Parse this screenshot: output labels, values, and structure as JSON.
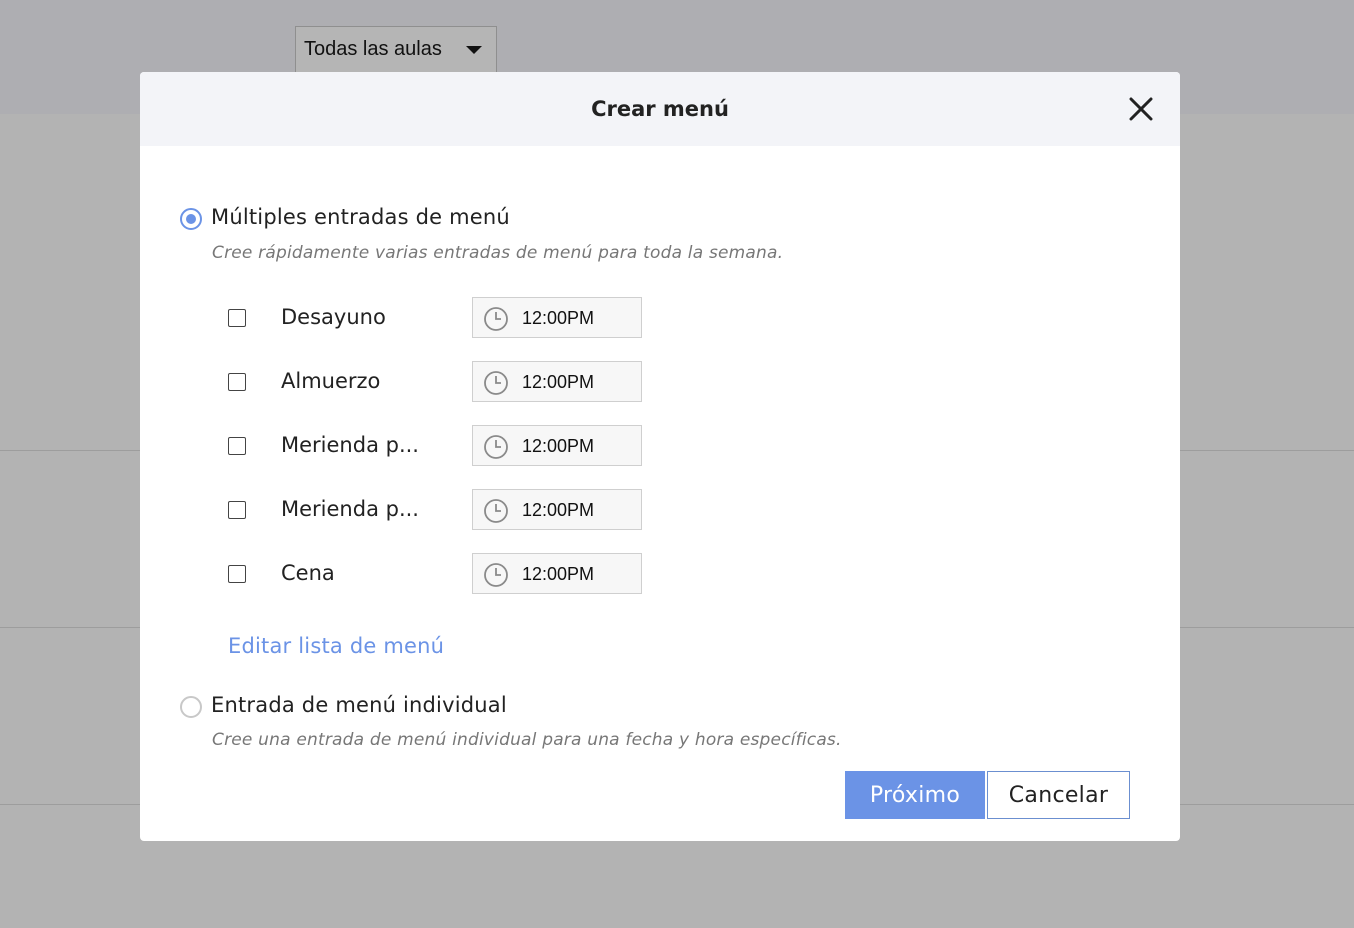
{
  "background": {
    "classroom_select": "Todas las aulas"
  },
  "dialog": {
    "title": "Crear menú",
    "multiple_option": {
      "label": "Múltiples entradas de menú",
      "description": "Cree rápidamente varias entradas de menú para toda la semana.",
      "selected": true
    },
    "meals": [
      {
        "name": "Desayuno",
        "time": "12:00PM",
        "checked": false
      },
      {
        "name": "Almuerzo",
        "time": "12:00PM",
        "checked": false
      },
      {
        "name": "Merienda p...",
        "time": "12:00PM",
        "checked": false
      },
      {
        "name": "Merienda p...",
        "time": "12:00PM",
        "checked": false
      },
      {
        "name": "Cena",
        "time": "12:00PM",
        "checked": false
      }
    ],
    "edit_link": "Editar lista de menú",
    "single_option": {
      "label": "Entrada de menú individual",
      "description": "Cree una entrada de menú individual para una fecha y hora específicas.",
      "selected": false
    },
    "next_button": "Próximo",
    "cancel_button": "Cancelar"
  },
  "colors": {
    "accent": "#6b93e6",
    "overlay": "#b3b3b3",
    "header_bg": "#f3f4f8"
  },
  "icons": {
    "close": "close-icon",
    "clock": "clock-icon",
    "select_caret": "caret-down-icon"
  }
}
